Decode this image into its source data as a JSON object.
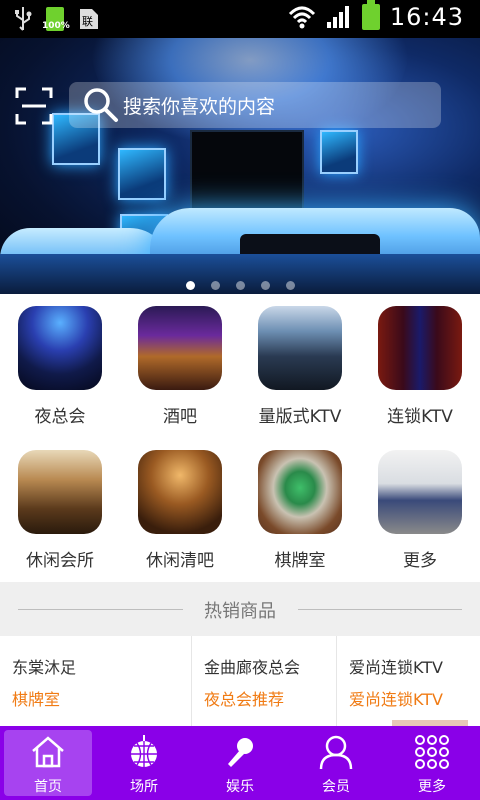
{
  "status_bar": {
    "time": "16:43",
    "battery_small_label": "100%",
    "icons": [
      "usb-icon",
      "battery-small-icon",
      "sim-icon",
      "wifi-icon",
      "signal-icon",
      "battery-icon"
    ]
  },
  "banner": {
    "search_placeholder": "搜索你喜欢的内容",
    "dots_count": 5,
    "active_dot": 0
  },
  "categories": [
    {
      "label": "夜总会",
      "icon": "nightclub-image"
    },
    {
      "label": "酒吧",
      "icon": "bar-image"
    },
    {
      "label": "量版式KTV",
      "icon": "ktv-image"
    },
    {
      "label": "连锁KTV",
      "icon": "chain-ktv-image"
    },
    {
      "label": "休闲会所",
      "icon": "club-image"
    },
    {
      "label": "休闲清吧",
      "icon": "lounge-image"
    },
    {
      "label": "棋牌室",
      "icon": "mahjong-image"
    },
    {
      "label": "更多",
      "icon": "meeting-room-image"
    }
  ],
  "hot_section": {
    "title": "热销商品",
    "items": [
      {
        "name": "东棠沐足",
        "tag": "棋牌室"
      },
      {
        "name": "金曲廊夜总会",
        "tag": "夜总会推荐"
      },
      {
        "name": "爱尚连锁KTV",
        "tag": "爱尚连锁KTV"
      }
    ]
  },
  "tabbar": {
    "active": 0,
    "tabs": [
      {
        "label": "首页",
        "icon": "home-icon"
      },
      {
        "label": "场所",
        "icon": "disco-ball-icon"
      },
      {
        "label": "娱乐",
        "icon": "microphone-icon"
      },
      {
        "label": "会员",
        "icon": "user-icon"
      },
      {
        "label": "更多",
        "icon": "grid-icon"
      }
    ]
  },
  "colors": {
    "tabbar_bg": "#8a00e8",
    "tabbar_active": "#a743f0",
    "tag_orange": "#f07b14"
  }
}
